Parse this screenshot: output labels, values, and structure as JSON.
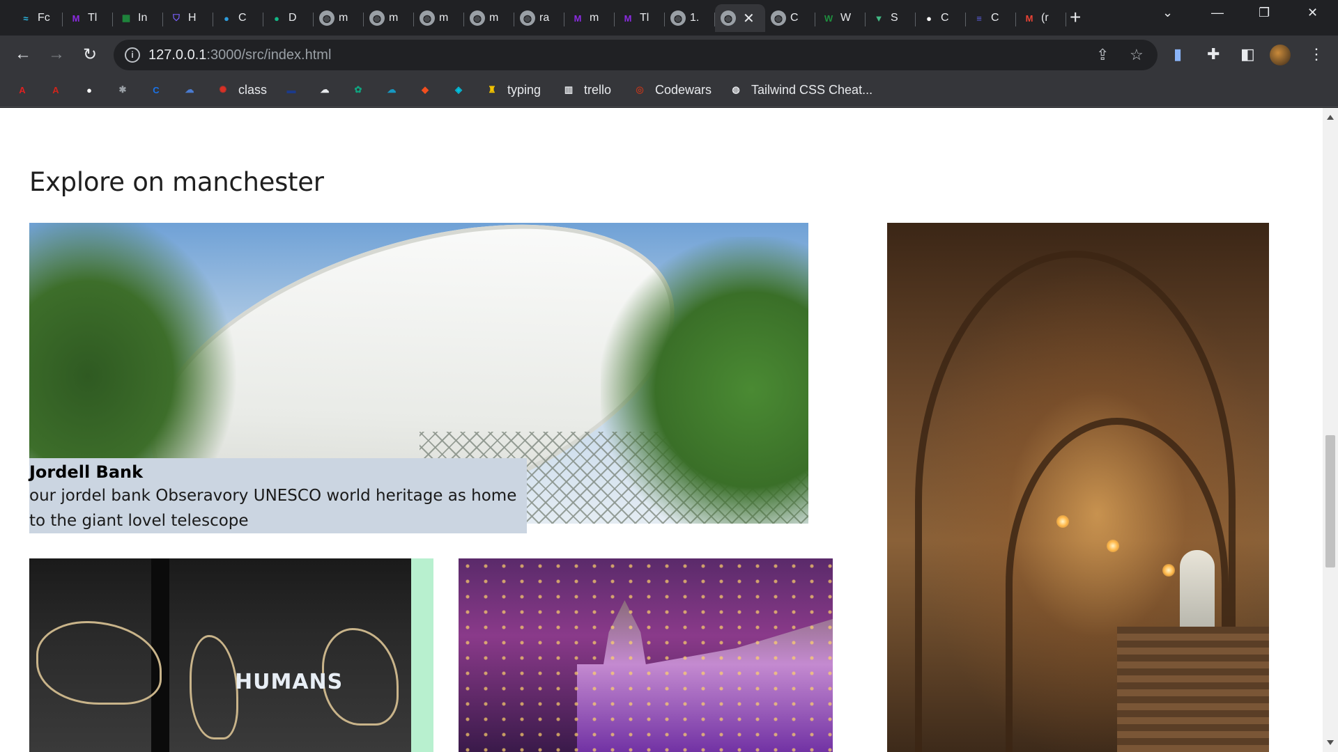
{
  "browser": {
    "tabs": [
      {
        "icon": "surf-icon",
        "title": "Fc",
        "color": "#2bbbe6"
      },
      {
        "icon": "m-icon",
        "title": "Tl",
        "color": "#8b2be2"
      },
      {
        "icon": "sheet-icon",
        "title": "In",
        "color": "#1e8e3e"
      },
      {
        "icon": "shield-icon",
        "title": "H",
        "color": "#7b61ff"
      },
      {
        "icon": "blue-drop-icon",
        "title": "C",
        "color": "#2d9cdb"
      },
      {
        "icon": "green-drop-icon",
        "title": "D",
        "color": "#12b886"
      },
      {
        "icon": "globe-icon",
        "title": "m",
        "color": "#9aa0a6"
      },
      {
        "icon": "globe-icon",
        "title": "m",
        "color": "#9aa0a6"
      },
      {
        "icon": "globe-icon",
        "title": "m",
        "color": "#9aa0a6"
      },
      {
        "icon": "globe-icon",
        "title": "m",
        "color": "#9aa0a6"
      },
      {
        "icon": "globe-icon",
        "title": "ra",
        "color": "#9aa0a6"
      },
      {
        "icon": "m-icon",
        "title": "m",
        "color": "#8b2be2"
      },
      {
        "icon": "m-icon",
        "title": "Tl",
        "color": "#8b2be2"
      },
      {
        "icon": "globe-icon",
        "title": "1.",
        "color": "#9aa0a6"
      },
      {
        "icon": "globe-icon",
        "title": "",
        "color": "#9aa0a6",
        "active": true
      },
      {
        "icon": "globe-icon",
        "title": "C",
        "color": "#9aa0a6"
      },
      {
        "icon": "w-icon",
        "title": "W",
        "color": "#1e8e3e"
      },
      {
        "icon": "vue-icon",
        "title": "S",
        "color": "#41b883"
      },
      {
        "icon": "github-icon",
        "title": "C",
        "color": "#ffffff"
      },
      {
        "icon": "list-icon",
        "title": "C",
        "color": "#5b5fe0"
      },
      {
        "icon": "gmail-icon",
        "title": "(r",
        "color": "#ea4335"
      }
    ],
    "active_tab_close": "✕",
    "new_tab": "+",
    "window_controls": {
      "dropdown": "⌄",
      "minimize": "—",
      "restore": "❐",
      "close": "✕"
    },
    "url_host": "127.0.0.1",
    "url_path": ":3000/src/index.html",
    "bookmarks": [
      {
        "icon": "acrobat-icon",
        "label": "",
        "color": "#e02020"
      },
      {
        "icon": "pdf-icon",
        "label": "",
        "color": "#d1241a"
      },
      {
        "icon": "github-icon",
        "label": "",
        "color": "#ffffff"
      },
      {
        "icon": "bug-icon",
        "label": "",
        "color": "#9aa0a6"
      },
      {
        "icon": "c-icon",
        "label": "",
        "color": "#1a73e8"
      },
      {
        "icon": "cloud-icon",
        "label": "",
        "color": "#4a7bd0"
      },
      {
        "icon": "class-icon",
        "label": "class",
        "color": "#d93025"
      },
      {
        "icon": "dash-icon",
        "label": "",
        "color": "#1b3a8a"
      },
      {
        "icon": "cloud-upload-icon",
        "label": "",
        "color": "#e8eaed"
      },
      {
        "icon": "chatgpt-icon",
        "label": "",
        "color": "#10a37f"
      },
      {
        "icon": "salesforce-icon",
        "label": "",
        "color": "#1798c1"
      },
      {
        "icon": "figma-icon",
        "label": "",
        "color": "#f24e1e"
      },
      {
        "icon": "diamond-icon",
        "label": "",
        "color": "#00c2e0"
      },
      {
        "icon": "typing-icon",
        "label": "typing",
        "color": "#f2c200"
      },
      {
        "icon": "trello-icon",
        "label": "trello",
        "color": "#e8eaed"
      },
      {
        "icon": "codewars-icon",
        "label": "Codewars",
        "color": "#b1361e"
      },
      {
        "icon": "globe-icon",
        "label": "Tailwind CSS Cheat...",
        "color": "#e8eaed"
      }
    ]
  },
  "page": {
    "title": "Explore on manchester",
    "featured": {
      "title": "Jordell Bank",
      "description": "our jordel bank Obseravory UNESCO world heritage as home to the giant lovel telescope"
    },
    "museum_sign": "HUMANS"
  }
}
